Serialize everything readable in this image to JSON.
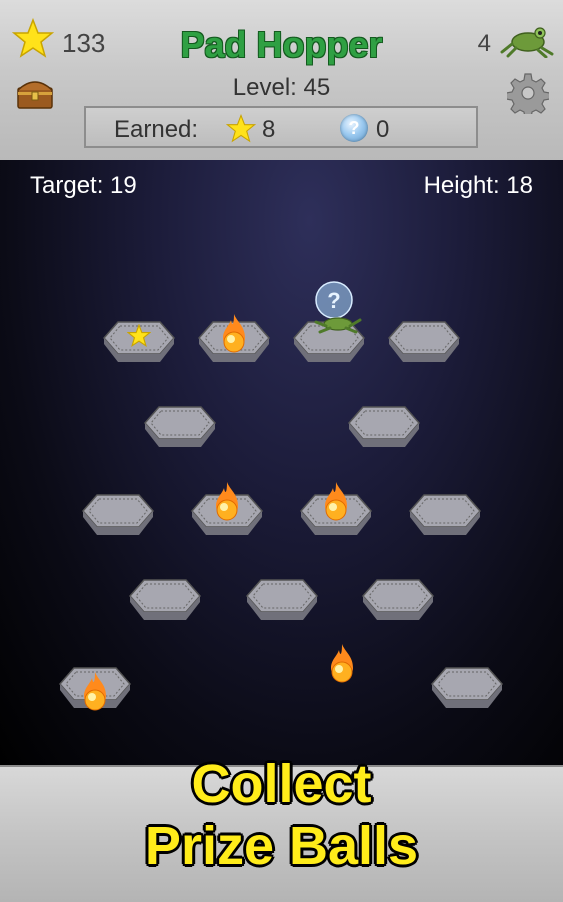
{
  "header": {
    "title": "Pad Hopper",
    "stars_total": "133",
    "lives": "4",
    "level_text": "Level: 45",
    "earned": {
      "label": "Earned:",
      "stars": "8",
      "prize_balls": "0"
    }
  },
  "field": {
    "target_text": "Target: 19",
    "height_text": "Height: 18"
  },
  "banner": {
    "line1": "Collect",
    "line2": "Prize Balls"
  },
  "colors": {
    "title_green": "#2fa043",
    "banner_yellow": "#ffec1a",
    "star_yellow": "#ffe21a",
    "pad_gray": "#9a9aa4"
  },
  "icons": {
    "star": "star-icon",
    "chest": "treasure-chest-icon",
    "gear": "gear-icon",
    "frog": "frog-icon",
    "prize": "question-ball-icon",
    "fire": "fireball-icon",
    "pad": "hex-pad-icon"
  }
}
